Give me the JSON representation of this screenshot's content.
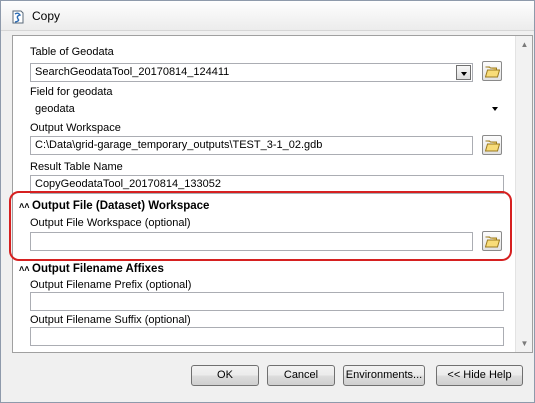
{
  "window": {
    "title": "Copy"
  },
  "form": {
    "table_label": "Table of Geodata",
    "table_value": "SearchGeodataTool_20170814_124411",
    "field_label": "Field for geodata",
    "field_value": "geodata",
    "workspace_label": "Output Workspace",
    "workspace_value": "C:\\Data\\grid-garage_temporary_outputs\\TEST_3-1_02.gdb",
    "result_label": "Result Table Name",
    "result_value": "CopyGeodataTool_20170814_133052"
  },
  "section_workspace": {
    "title": "Output File (Dataset) Workspace",
    "file_workspace_label": "Output File Workspace (optional)",
    "file_workspace_value": ""
  },
  "section_affixes": {
    "title": "Output Filename Affixes",
    "prefix_label": "Output Filename Prefix (optional)",
    "prefix_value": "",
    "suffix_label": "Output Filename Suffix (optional)",
    "suffix_value": ""
  },
  "buttons": {
    "ok": "OK",
    "cancel": "Cancel",
    "environments": "Environments...",
    "hide_help": "<< Hide Help"
  },
  "icons": {
    "app": "toolbox-script-icon",
    "browse": "open-folder-icon",
    "collapse": "double-chevron-up-icon"
  },
  "colors": {
    "highlight": "#d62020"
  }
}
